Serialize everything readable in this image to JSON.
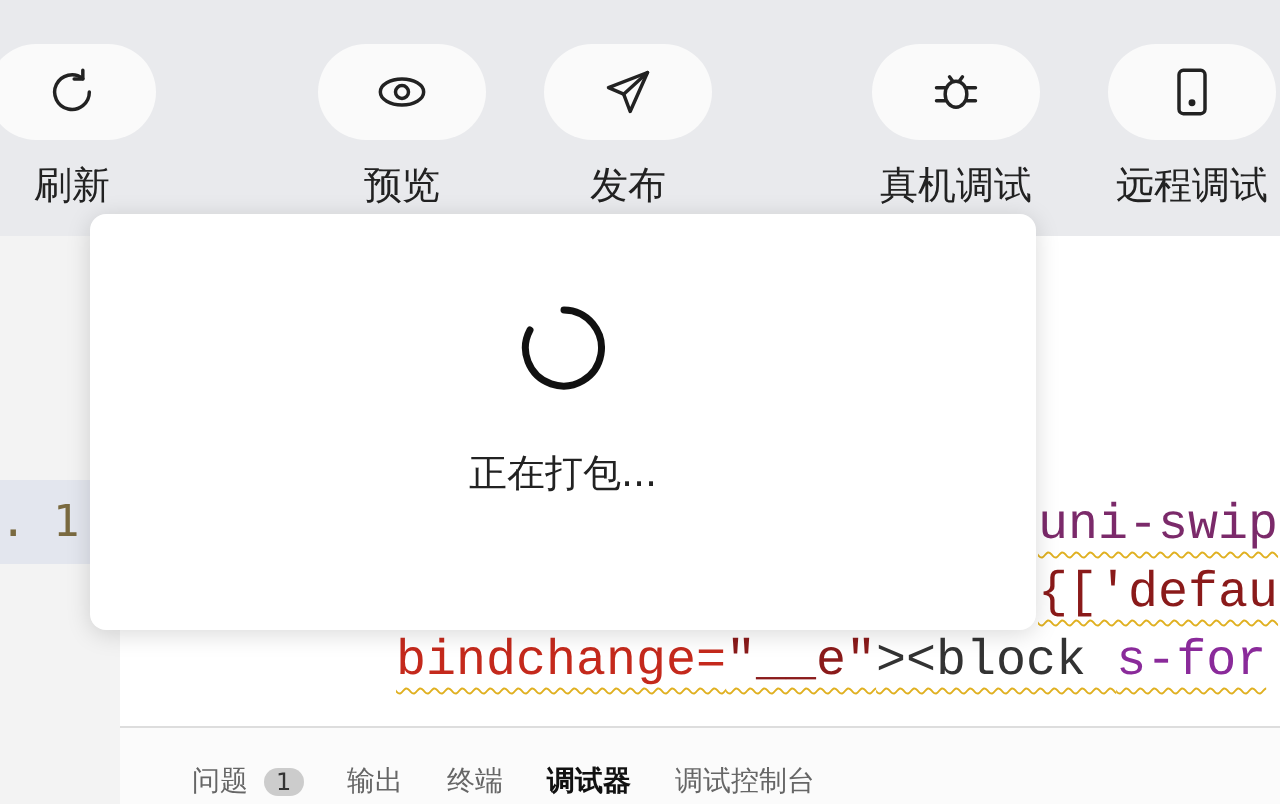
{
  "toolbar": [
    {
      "label": "刷新"
    },
    {
      "label": "预览"
    },
    {
      "label": "发布"
    },
    {
      "label": "真机调试"
    },
    {
      "label": "远程调试"
    }
  ],
  "editor": {
    "line_number": ". 1",
    "code_lines": [
      {
        "parts": [
          {
            "text": "uni-swip",
            "kind": "tag"
          }
        ]
      },
      {
        "parts": [
          {
            "text": "{['defau",
            "kind": "string"
          }
        ]
      },
      {
        "parts": [
          {
            "text": "bindchange=",
            "kind": "attr"
          },
          {
            "text": "\"__e\"",
            "kind": "string"
          },
          {
            "text": "><block ",
            "kind": "punct"
          },
          {
            "text": "s-for",
            "kind": "attr2"
          }
        ]
      }
    ]
  },
  "dialog": {
    "message": "正在打包..."
  },
  "panel_tabs": [
    {
      "label": "问题",
      "badge": "1",
      "selected": false
    },
    {
      "label": "输出",
      "selected": false
    },
    {
      "label": "终端",
      "selected": false
    },
    {
      "label": "调试器",
      "selected": true
    },
    {
      "label": "调试控制台",
      "selected": false
    }
  ]
}
